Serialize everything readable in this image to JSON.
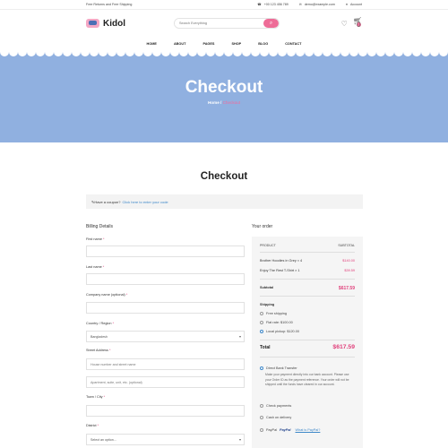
{
  "topbar": {
    "promo": "Free Returns and Free Shipping",
    "phone": "+00 123 456 789",
    "email": "demo@example.com",
    "account": "Account"
  },
  "header": {
    "logo_text": "Kidol",
    "search_placeholder": "Search Everything",
    "cart_count": "0"
  },
  "nav": [
    "HOME",
    "ABOUT",
    "PAGES",
    "SHOP",
    "BLOG",
    "CONTACT"
  ],
  "hero": {
    "title": "Checkout",
    "crumb_home": "Home",
    "crumb_sep": "/",
    "crumb_current": "Checkout",
    "bg_color": "#90b0e0"
  },
  "page": {
    "title": "Checkout",
    "coupon_text": "Have a coupon?",
    "coupon_link": "Click here to enter your code"
  },
  "billing": {
    "title": "Billing Details",
    "first_name": "First name",
    "last_name": "Last name",
    "company": "Company name (optional)",
    "country": "Country / Region",
    "country_value": "Bangladesh",
    "street": "Street Address",
    "street_placeholder": "House number and street name",
    "apt_placeholder": "Apartment, suite, unit, etc. (optional)",
    "city": "Town / City",
    "district": "District",
    "district_value": "Select an option..."
  },
  "order": {
    "title": "Your order",
    "col_product": "PRODUCT",
    "col_subtotal": "SUBTOTAL",
    "items": [
      {
        "name": "Brother Hoodies in Grey × 4",
        "price": "$140.00"
      },
      {
        "name": "Enjoy The Rest T-Shirt × 1",
        "price": "$39.59"
      }
    ],
    "subtotal_label": "Subtotal",
    "subtotal_value": "$617.59",
    "shipping_label": "Shipping",
    "shipping_options": [
      "Free shipping",
      "Flat rate: $100.00",
      "Local pickup: $120.00"
    ],
    "total_label": "Total",
    "total_value": "$617.59",
    "payments": {
      "bank": "Direct Bank Transfer",
      "bank_desc": "Make your payment directly into our bank account. Please use your Order ID as the payment reference. Your order will not be shipped until the funds have cleared in our account.",
      "check": "Check payments",
      "cod": "Cash on delivery",
      "paypal": "PayPal",
      "paypal_logo": "PayPal",
      "paypal_link": "What is PayPal?"
    }
  },
  "colors": {
    "accent": "#ee6c97",
    "link": "#3e88c9",
    "hero": "#90b0e0"
  }
}
